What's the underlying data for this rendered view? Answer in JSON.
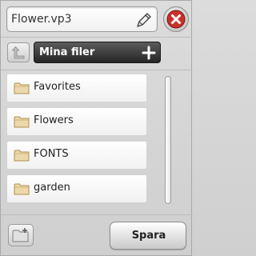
{
  "header": {
    "filename": "Flower.vp3",
    "edit_icon": "pencil-icon",
    "close_icon": "close-icon"
  },
  "navigation": {
    "up_icon": "up-arrow-icon",
    "current_folder": "Mina filer",
    "add_icon": "plus-icon"
  },
  "list": {
    "items": [
      {
        "label": "Favorites",
        "icon": "folder-icon"
      },
      {
        "label": "Flowers",
        "icon": "folder-icon"
      },
      {
        "label": "FONTS",
        "icon": "folder-icon"
      },
      {
        "label": "garden",
        "icon": "folder-icon"
      }
    ]
  },
  "footer": {
    "new_folder_icon": "new-folder-icon",
    "save_label": "Spara"
  },
  "colors": {
    "close_red": "#c8322b",
    "selector_dark": "#2a2a2a",
    "folder_tan": "#e9d5a8"
  }
}
